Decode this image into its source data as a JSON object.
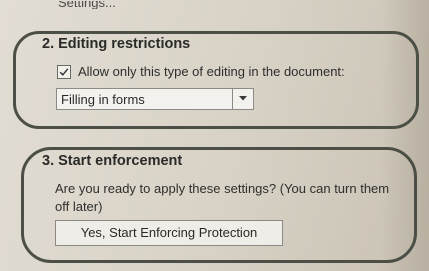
{
  "top_partial_text": "Settings...",
  "editing_restrictions": {
    "heading": "2. Editing restrictions",
    "checkbox_label": "Allow only this type of editing in the document:",
    "checkbox_checked": true,
    "dropdown_value": "Filling in forms"
  },
  "start_enforcement": {
    "heading": "3. Start enforcement",
    "description": "Are you ready to apply these settings? (You can turn them off later)",
    "button_label": "Yes, Start Enforcing Protection"
  },
  "icons": {
    "checkbox": "checkmark-icon",
    "dropdown": "chevron-down-icon"
  }
}
